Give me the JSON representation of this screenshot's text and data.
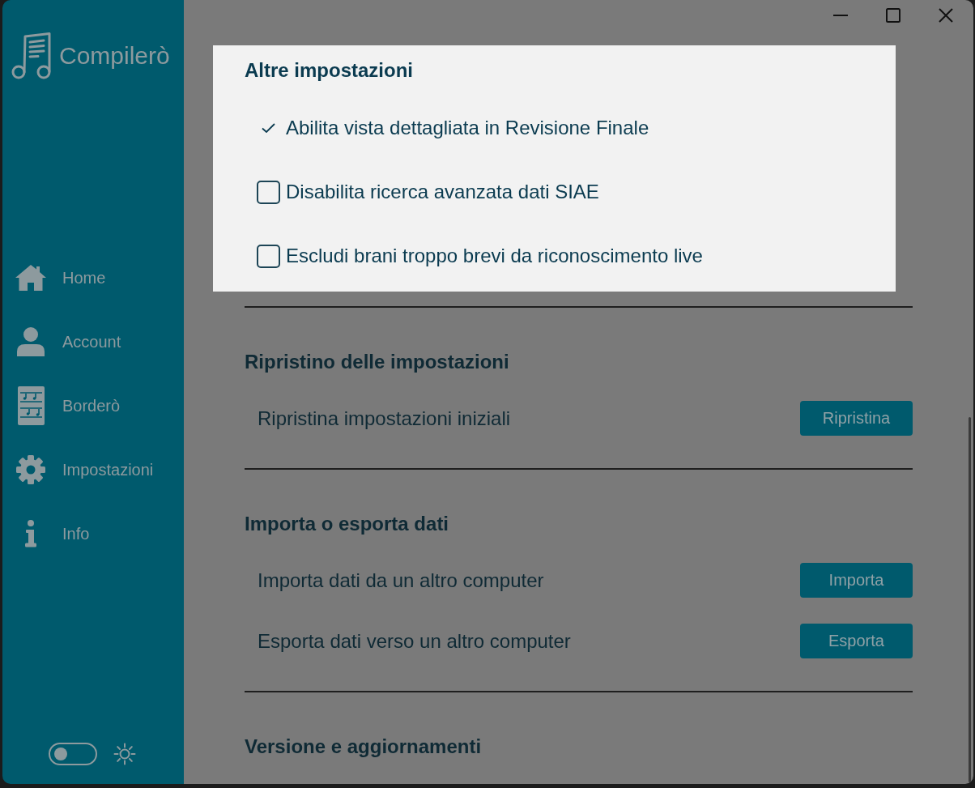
{
  "sidebar": {
    "app_name": "Compilerò",
    "items": [
      {
        "label": "Home",
        "selected": false
      },
      {
        "label": "Account",
        "selected": false
      },
      {
        "label": "Borderò",
        "selected": false
      },
      {
        "label": "Impostazioni",
        "selected": false
      },
      {
        "label": "Info",
        "selected": false
      }
    ],
    "theme_switch": {
      "on": false
    }
  },
  "popup": {
    "title": "Altre impostazioni",
    "options": [
      {
        "label": "Abilita vista dettagliata in Revisione Finale",
        "checked": true
      },
      {
        "label": "Disabilita ricerca avanzata dati SIAE",
        "checked": false
      },
      {
        "label": "Escludi brani troppo brevi da riconoscimento live",
        "checked": false
      }
    ]
  },
  "sections": [
    {
      "title": "Ripristino delle impostazioni",
      "rows": [
        {
          "label": "Ripristina impostazioni iniziali",
          "button": "Ripristina"
        }
      ]
    },
    {
      "title": "Importa o esporta dati",
      "rows": [
        {
          "label": "Importa dati da un altro computer",
          "button": "Importa"
        },
        {
          "label": "Esporta dati verso un altro computer",
          "button": "Esporta"
        }
      ]
    },
    {
      "title": "Versione e aggiornamenti"
    }
  ]
}
